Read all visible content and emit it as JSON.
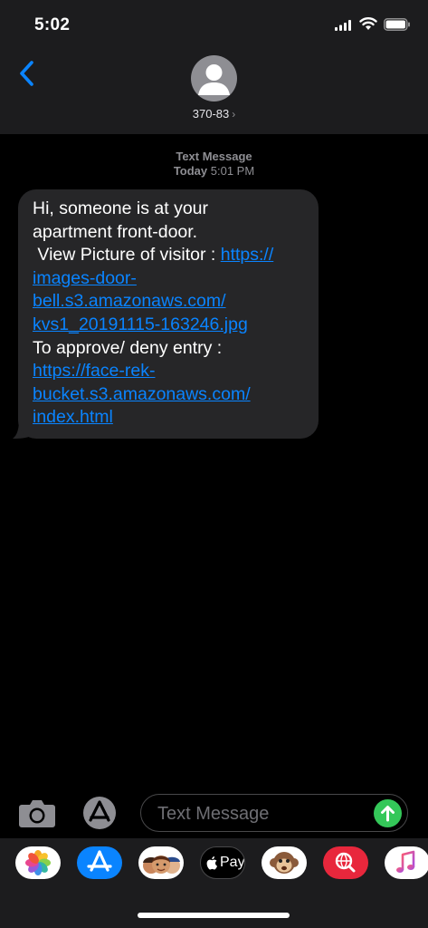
{
  "status_bar": {
    "time": "5:02"
  },
  "header": {
    "contact_name": "370-83",
    "chevron": "›"
  },
  "thread": {
    "label": "Text Message",
    "date": "Today",
    "time": "5:01 PM"
  },
  "message": {
    "line1": "Hi, someone is at your",
    "line2": "apartment front-door.",
    "line3_text": " View Picture of visitor : ",
    "link1": [
      "https://",
      "images-door-",
      "bell.s3.amazonaws.com/",
      "kvs1_20191115-163246.jpg"
    ],
    "line_approve": "To approve/ deny entry :",
    "link2": [
      "https://face-rek-",
      "bucket.s3.amazonaws.com/",
      "index.html"
    ]
  },
  "compose": {
    "placeholder": "Text Message"
  },
  "app_drawer": {
    "apps": [
      "photos-icon",
      "app-store-icon",
      "memoji-icon",
      "apple-pay-icon",
      "monkey-animoji-icon",
      "web-search-icon",
      "music-icon"
    ],
    "apple_pay_label": "Pay"
  },
  "colors": {
    "link": "#0a84ff",
    "bubble": "#262628",
    "send": "#34c759",
    "app_store": "#0a84ff"
  }
}
